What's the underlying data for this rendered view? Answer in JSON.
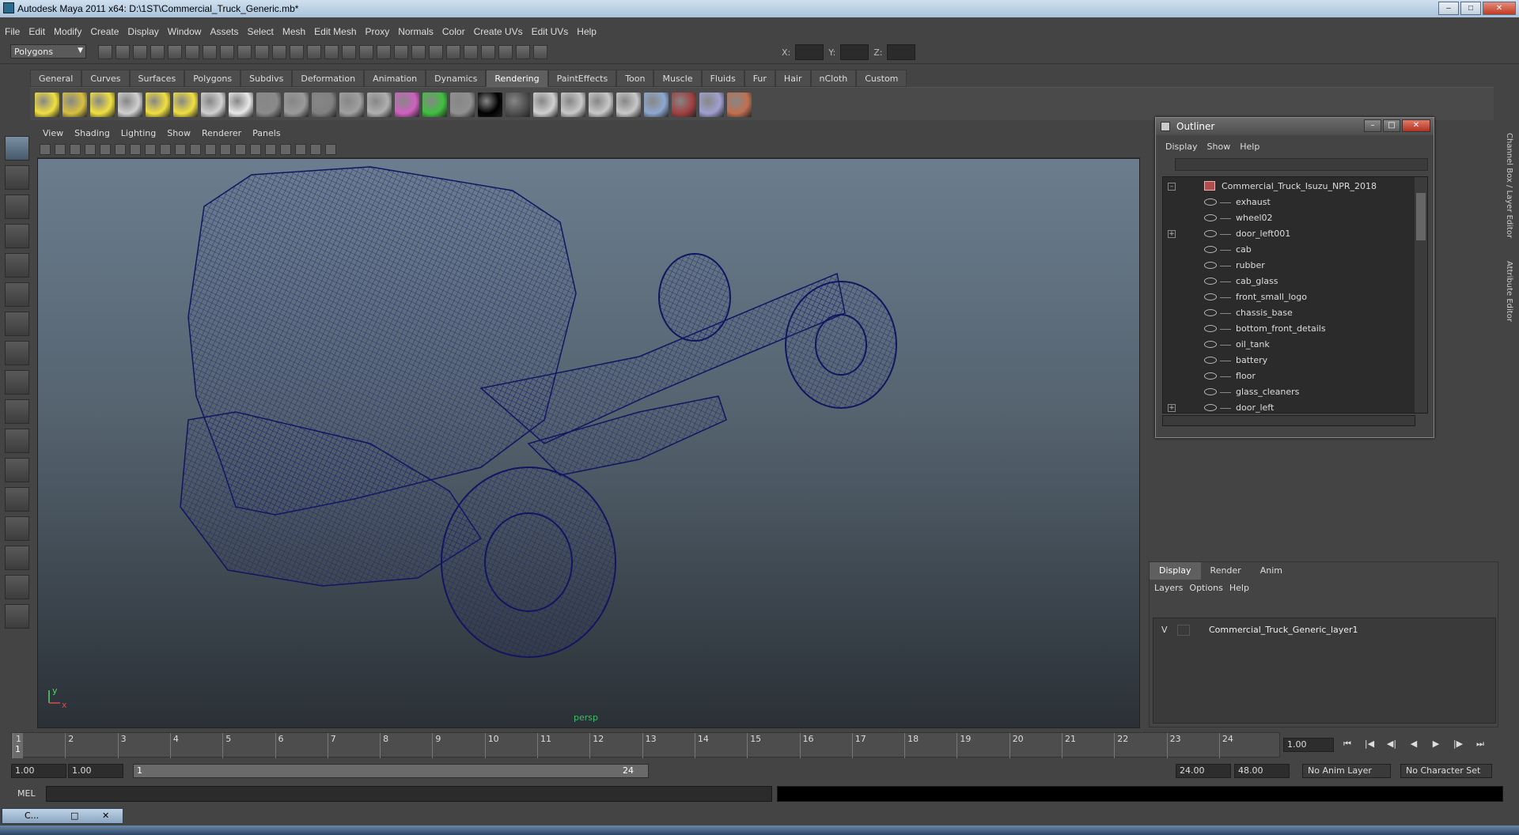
{
  "window": {
    "title": "Autodesk Maya 2011 x64: D:\\1ST\\Commercial_Truck_Generic.mb*"
  },
  "menubar": [
    "File",
    "Edit",
    "Modify",
    "Create",
    "Display",
    "Window",
    "Assets",
    "Select",
    "Mesh",
    "Edit Mesh",
    "Proxy",
    "Normals",
    "Color",
    "Create UVs",
    "Edit UVs",
    "Help"
  ],
  "statusline": {
    "mode": "Polygons",
    "x_label": "X:",
    "y_label": "Y:",
    "z_label": "Z:"
  },
  "shelf": {
    "tabs": [
      "General",
      "Curves",
      "Surfaces",
      "Polygons",
      "Subdivs",
      "Deformation",
      "Animation",
      "Dynamics",
      "Rendering",
      "PaintEffects",
      "Toon",
      "Muscle",
      "Fluids",
      "Fur",
      "Hair",
      "nCloth",
      "Custom"
    ],
    "active": "Rendering",
    "icon_colors": [
      "#f0e040",
      "#d8c040",
      "#f0e040",
      "#d0d0d0",
      "#f0e040",
      "#f0e040",
      "#d0d0d0",
      "#e8e8e8",
      "#8a8a8a",
      "#9a9a9a",
      "#808080",
      "#a0a0a0",
      "#b0b0b0",
      "#d060c0",
      "#40c040",
      "#909090",
      "#000000",
      "#505050",
      "#d0d0d0",
      "#c8c8c8",
      "#c8c8c8",
      "#c8c8c8",
      "#8ea8d0",
      "#a04040",
      "#a0a0d0",
      "#c07050"
    ]
  },
  "viewport": {
    "menu": [
      "View",
      "Shading",
      "Lighting",
      "Show",
      "Renderer",
      "Panels"
    ],
    "camera_label": "persp",
    "axis_y": "y",
    "axis_x": "x"
  },
  "outliner": {
    "title": "Outliner",
    "menu": [
      "Display",
      "Show",
      "Help"
    ],
    "root": "Commercial_Truck_Isuzu_NPR_2018",
    "items": [
      {
        "name": "exhaust",
        "exp": ""
      },
      {
        "name": "wheel02",
        "exp": ""
      },
      {
        "name": "door_left001",
        "exp": "+"
      },
      {
        "name": "cab",
        "exp": ""
      },
      {
        "name": "rubber",
        "exp": ""
      },
      {
        "name": "cab_glass",
        "exp": ""
      },
      {
        "name": "front_small_logo",
        "exp": ""
      },
      {
        "name": "chassis_base",
        "exp": ""
      },
      {
        "name": "bottom_front_details",
        "exp": ""
      },
      {
        "name": "oil_tank",
        "exp": ""
      },
      {
        "name": "battery",
        "exp": ""
      },
      {
        "name": "floor",
        "exp": ""
      },
      {
        "name": "glass_cleaners",
        "exp": ""
      },
      {
        "name": "door_left",
        "exp": "+"
      }
    ]
  },
  "layer_editor": {
    "tabs": [
      "Display",
      "Render",
      "Anim"
    ],
    "active": "Display",
    "menu": [
      "Layers",
      "Options",
      "Help"
    ],
    "layer_visible": "V",
    "layer_name": "Commercial_Truck_Generic_layer1"
  },
  "right_tabs": [
    "Channel Box / Layer Editor",
    "Attribute Editor"
  ],
  "timeline": {
    "ticks": [
      "1",
      "2",
      "3",
      "4",
      "5",
      "6",
      "7",
      "8",
      "9",
      "10",
      "11",
      "12",
      "13",
      "14",
      "15",
      "16",
      "17",
      "18",
      "19",
      "20",
      "21",
      "22",
      "23",
      "24"
    ],
    "current": "1",
    "current_time": "1.00"
  },
  "range": {
    "start": "1.00",
    "playback_start": "1.00",
    "slider_start": "1",
    "slider_end": "24",
    "playback_end": "24.00",
    "end": "48.00",
    "anim_layer": "No Anim Layer",
    "char_set": "No Character Set"
  },
  "cmd": {
    "label": "MEL"
  },
  "minimized": {
    "label": "C..."
  }
}
